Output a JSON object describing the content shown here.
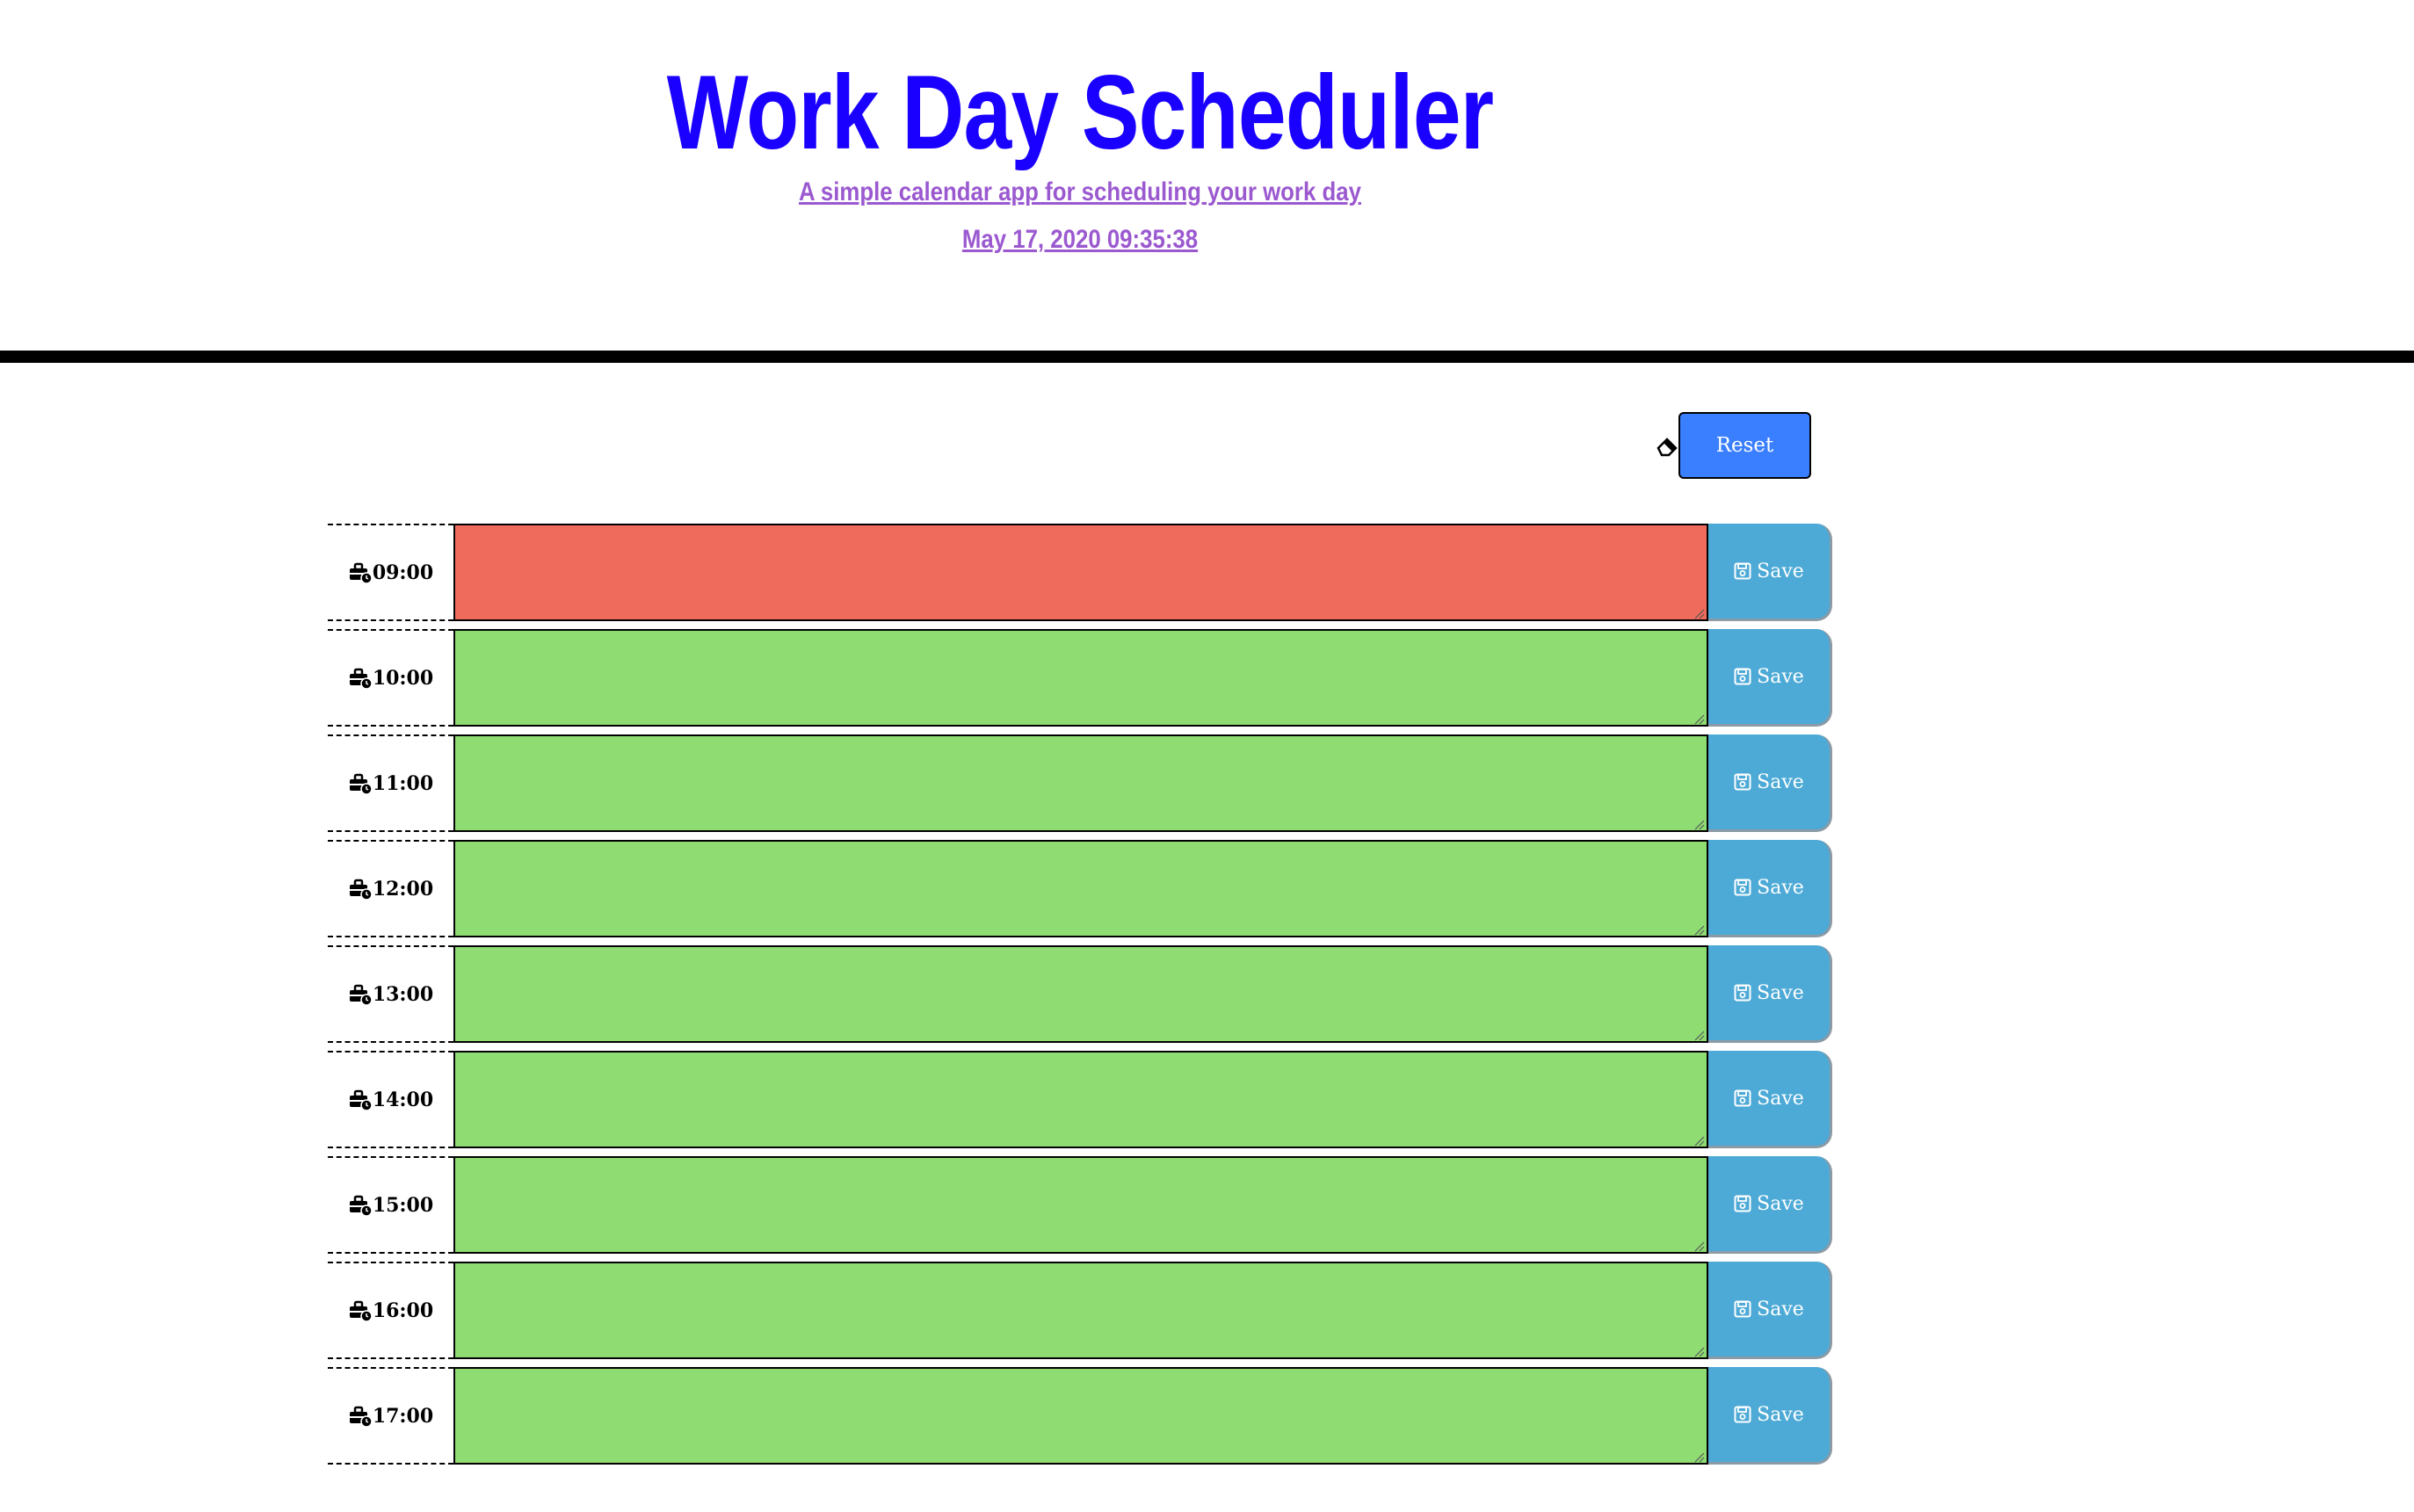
{
  "header": {
    "title": "Work Day Scheduler",
    "subtitle": "A simple calendar app for scheduling your work day",
    "datetime": "May 17, 2020 09:35:38"
  },
  "controls": {
    "reset_label": "Reset",
    "reset_icon": "eraser-icon"
  },
  "colors": {
    "title": "#1a00ff",
    "subtitle": "#9b59d0",
    "reset_bg": "#3a7fff",
    "past": "#ef6b5c",
    "present": "#ef6b5c",
    "future": "#8fdc73",
    "save_bg": "#4daad6"
  },
  "save_label": "Save",
  "save_icon": "floppy-disk-icon",
  "hour_icon": "business-time-icon",
  "rows": [
    {
      "hour": "09:00",
      "status": "present",
      "text": ""
    },
    {
      "hour": "10:00",
      "status": "future",
      "text": ""
    },
    {
      "hour": "11:00",
      "status": "future",
      "text": ""
    },
    {
      "hour": "12:00",
      "status": "future",
      "text": ""
    },
    {
      "hour": "13:00",
      "status": "future",
      "text": ""
    },
    {
      "hour": "14:00",
      "status": "future",
      "text": ""
    },
    {
      "hour": "15:00",
      "status": "future",
      "text": ""
    },
    {
      "hour": "16:00",
      "status": "future",
      "text": ""
    },
    {
      "hour": "17:00",
      "status": "future",
      "text": ""
    }
  ]
}
